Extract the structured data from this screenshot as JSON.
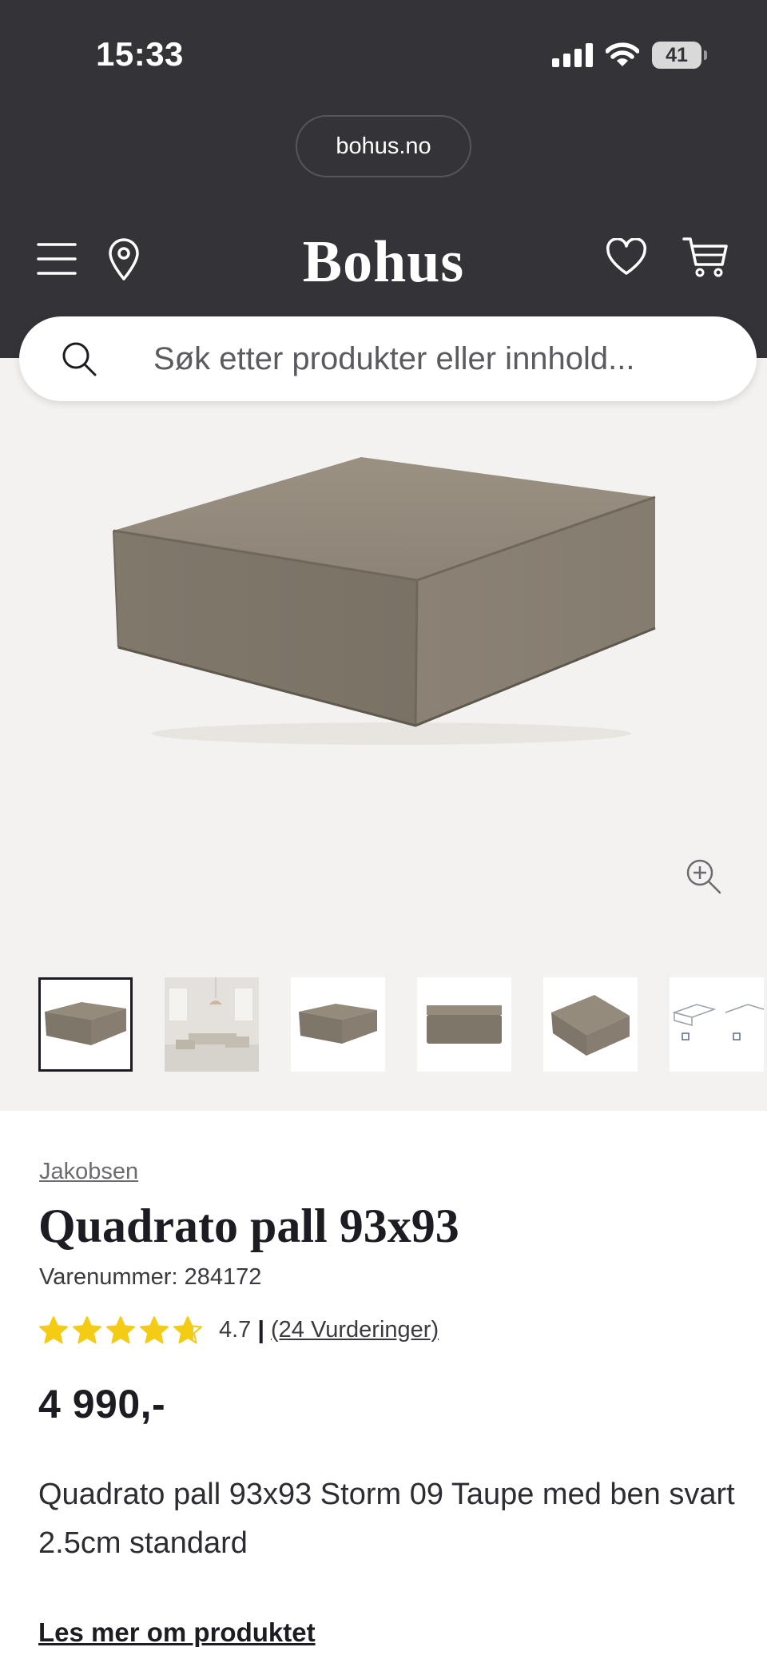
{
  "status_bar": {
    "time": "15:33",
    "battery": "41"
  },
  "browser": {
    "url": "bohus.no"
  },
  "header": {
    "logo": "Bohus"
  },
  "search": {
    "placeholder": "Søk etter produkter eller innhold..."
  },
  "gallery": {
    "thumbnail_count": 6,
    "active_thumbnail": 1
  },
  "product": {
    "brand": "Jakobsen",
    "title": "Quadrato pall 93x93",
    "sku_label": "Varenummer:",
    "sku": "284172",
    "rating": 4.7,
    "rating_text": "4.7",
    "rating_separator": "|",
    "review_count_text": "(24 Vurderinger)",
    "price": "4 990,-",
    "description": "Quadrato pall 93x93 Storm 09 Taupe med ben svart 2.5cm standard",
    "read_more": "Les mer om produktet"
  },
  "colors": {
    "header_bg": "#343338",
    "star": "#f5cc14",
    "gallery_bg": "#f4f2f0",
    "sofa": "#8a7f71"
  }
}
